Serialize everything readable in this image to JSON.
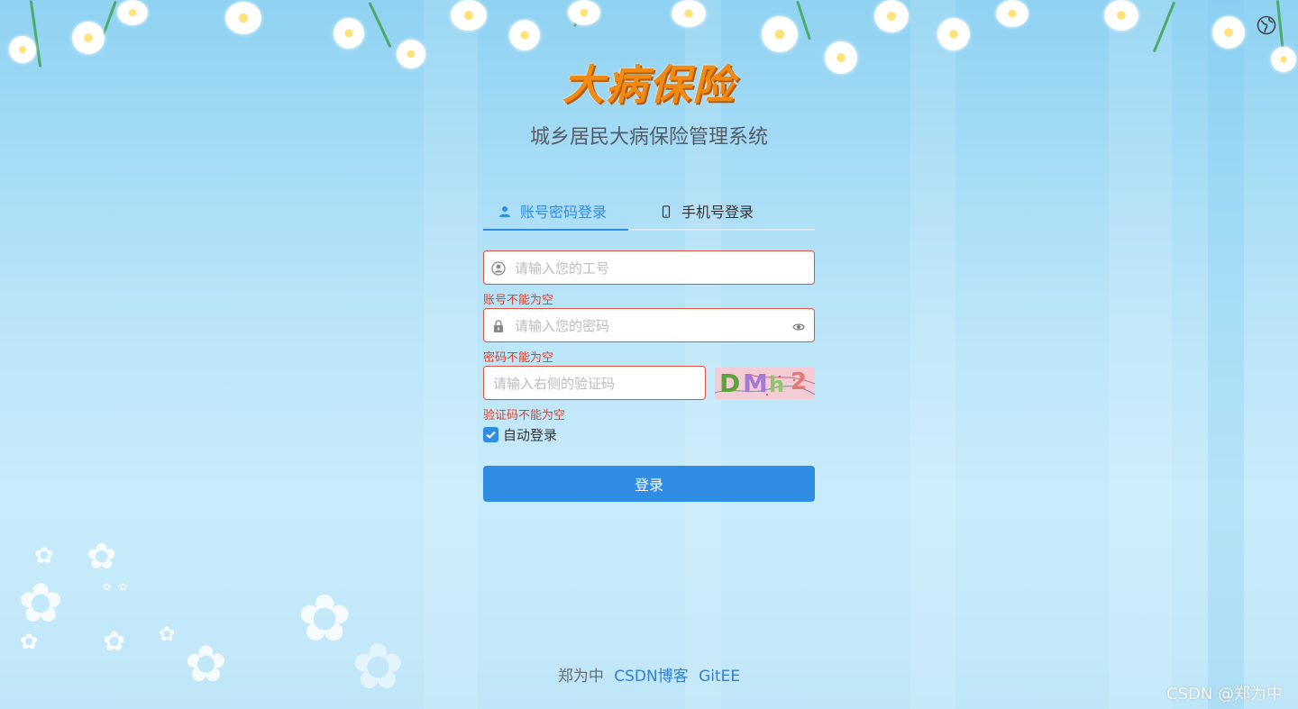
{
  "header": {
    "logo_text": "大病保险",
    "subtitle": "城乡居民大病保险管理系统",
    "language_icon": "globe-icon"
  },
  "tabs": [
    {
      "label": "账号密码登录",
      "icon": "user-icon",
      "active": true
    },
    {
      "label": "手机号登录",
      "icon": "mobile-icon",
      "active": false
    }
  ],
  "form": {
    "username": {
      "placeholder": "请输入您的工号",
      "value": "",
      "icon": "user-circle-icon",
      "error": "账号不能为空"
    },
    "password": {
      "placeholder": "请输入您的密码",
      "value": "",
      "icon": "lock-icon",
      "toggle_icon": "eye-icon",
      "error": "密码不能为空"
    },
    "captcha": {
      "placeholder": "请输入右侧的验证码",
      "value": "",
      "error": "验证码不能为空",
      "image_text": [
        "D",
        "M",
        "h",
        "2"
      ]
    },
    "remember_label": "自动登录",
    "remember_checked": true,
    "submit_label": "登录"
  },
  "footer": {
    "author": "郑为中",
    "links": [
      "CSDN博客",
      "GitEE"
    ]
  },
  "watermark": "CSDN @郑为中",
  "colors": {
    "accent": "#2f8de4",
    "error": "#e1402a",
    "logo": "#f08a12"
  }
}
